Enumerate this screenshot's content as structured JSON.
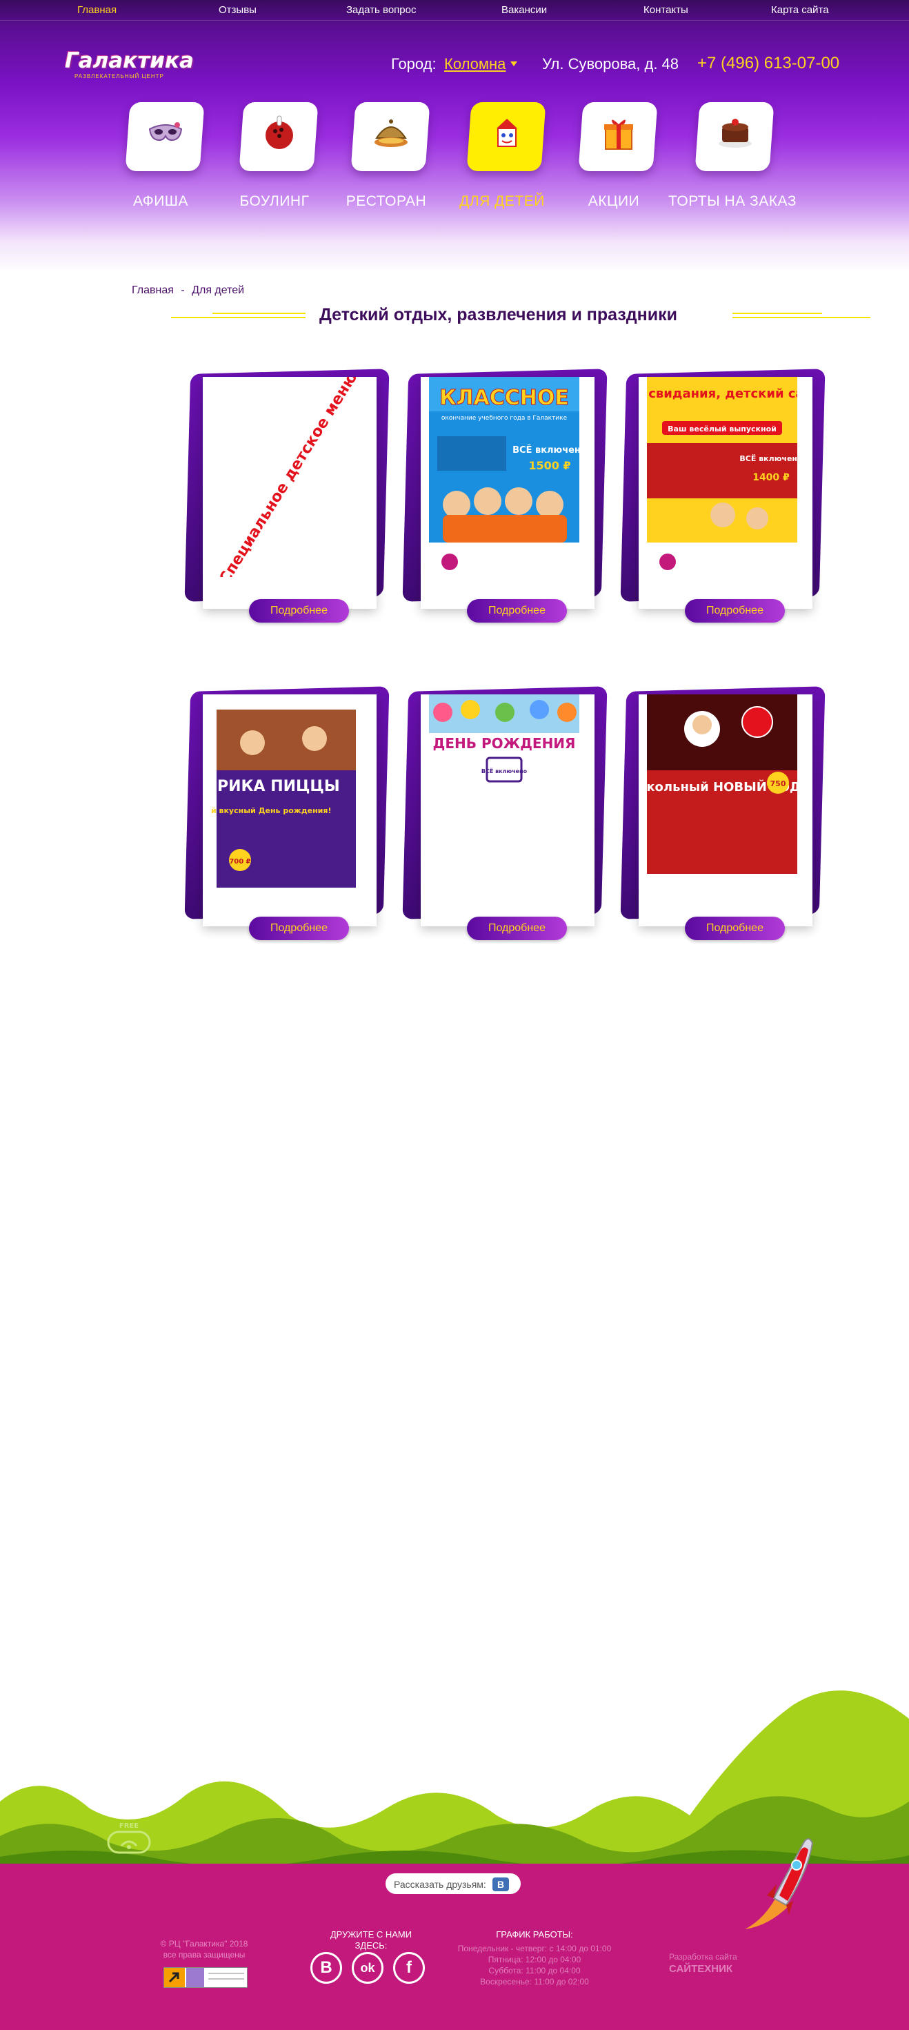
{
  "topnav": [
    {
      "label": "Главная",
      "active": true
    },
    {
      "label": "Отзывы"
    },
    {
      "label": "Задать вопрос"
    },
    {
      "label": "Вакансии"
    },
    {
      "label": "Контакты"
    },
    {
      "label": "Карта сайта"
    }
  ],
  "brand": {
    "name": "Галактика",
    "tagline": "РАЗВЛЕКАТЕЛЬНЫЙ ЦЕНТР"
  },
  "header": {
    "city_label": "Город:",
    "city_value": "Коломна",
    "address": "Ул. Суворова, д. 48",
    "phone": "+7 (496) 613-07-00"
  },
  "categories": [
    {
      "label": "АФИША",
      "icon": "mask-icon"
    },
    {
      "label": "БОУЛИНГ",
      "icon": "bowling-icon"
    },
    {
      "label": "РЕСТОРАН",
      "icon": "dish-icon"
    },
    {
      "label": "ДЛЯ ДЕТЕЙ",
      "icon": "kids-icon",
      "active": true
    },
    {
      "label": "АКЦИИ",
      "icon": "gift-icon"
    },
    {
      "label": "ТОРТЫ НА ЗАКАЗ",
      "icon": "cake-icon"
    }
  ],
  "breadcrumb": {
    "home": "Главная",
    "separator": "-",
    "current": "Для детей"
  },
  "page_title": "Детский отдых, развлечения и праздники",
  "cards": [
    {
      "poster_text": "Специальное детское меню",
      "button": "Подробнее"
    },
    {
      "poster_title": "КЛАССНОЕ",
      "poster_sub": "окончание учебного года в Галактике",
      "poster_badge": "ВСЁ включено",
      "poster_price": "1500 ₽",
      "button": "Подробнее"
    },
    {
      "poster_title": "До свидания, детский сад!",
      "poster_sub": "Ваш весёлый выпускной",
      "poster_badge": "ВСЁ включено",
      "poster_price": "1400 ₽",
      "button": "Подробнее"
    },
    {
      "poster_title": "ФАБРИКА ПИЦЦЫ",
      "poster_sub": "Самый вкусный День рождения!",
      "poster_price": "700 ₽",
      "button": "Подробнее"
    },
    {
      "poster_title": "ДЕНЬ РОЖДЕНИЯ",
      "poster_badge": "ВСЁ включено",
      "button": "Подробнее"
    },
    {
      "poster_title": "Школьный НОВЫЙ ГОД",
      "poster_price": "750",
      "button": "Подробнее"
    }
  ],
  "footer": {
    "share_label": "Рассказать друзьям:",
    "share_vk": "В",
    "copyright_line1": "© РЦ \"Галактика\" 2018",
    "copyright_line2": "все права защищены",
    "follow_title": "ДРУЖИТЕ С НАМИ ЗДЕСЬ:",
    "social": [
      {
        "name": "vk",
        "glyph": "В"
      },
      {
        "name": "odnoklassniki",
        "glyph": "ok"
      },
      {
        "name": "facebook",
        "glyph": "f"
      }
    ],
    "schedule_title": "ГРАФИК РАБОТЫ:",
    "schedule": [
      "Понедельник - четверг: с 14:00 до 01:00",
      "Пятница: 12:00 до 04:00",
      "Суббота: 11:00 до 04:00",
      "Воскресенье: 11:00 до 02:00"
    ],
    "developer_label": "Разработка сайта",
    "developer_name": "САЙТЕХНИК",
    "wifi_label": "FREE"
  },
  "colors": {
    "header_purple": "#7a12c4",
    "accent_yellow": "#ffd21f",
    "title_purple": "#3d0d5c",
    "footer_magenta": "#c3187c",
    "hill_green": "#9acb1a"
  }
}
